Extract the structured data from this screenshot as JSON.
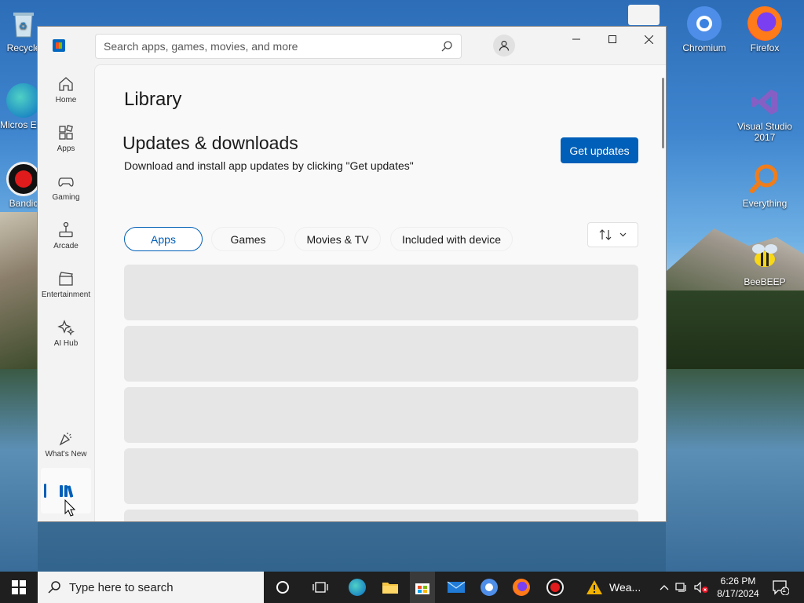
{
  "desktop": {
    "icons": [
      {
        "label": "Recycle",
        "name": "recycle-bin"
      },
      {
        "label": "Micros Edg",
        "name": "microsoft-edge"
      },
      {
        "label": "Bandic",
        "name": "bandicam"
      },
      {
        "label": "Chromium",
        "name": "chromium"
      },
      {
        "label": "Firefox",
        "name": "firefox"
      },
      {
        "label": "Visual Studio 2017",
        "name": "visual-studio"
      },
      {
        "label": "Everything",
        "name": "everything"
      },
      {
        "label": "BeeBEEP",
        "name": "beebeep"
      }
    ]
  },
  "window": {
    "search_placeholder": "Search apps, games, movies, and more"
  },
  "sidebar": {
    "items": [
      {
        "label": "Home"
      },
      {
        "label": "Apps"
      },
      {
        "label": "Gaming"
      },
      {
        "label": "Arcade"
      },
      {
        "label": "Entertainment"
      },
      {
        "label": "AI Hub"
      },
      {
        "label": "What's New"
      }
    ]
  },
  "content": {
    "page_title": "Library",
    "section_title": "Updates & downloads",
    "section_desc": "Download and install app updates by clicking \"Get updates\"",
    "get_updates_label": "Get updates",
    "filters": [
      {
        "label": "Apps",
        "active": true
      },
      {
        "label": "Games",
        "active": false
      },
      {
        "label": "Movies & TV",
        "active": false
      },
      {
        "label": "Included with device",
        "active": false
      }
    ]
  },
  "taskbar": {
    "search_text": "Type here to search",
    "weather_label": "Wea...",
    "time": "6:26 PM",
    "date": "8/17/2024",
    "notification_count": "1"
  },
  "colors": {
    "accent": "#005fb8",
    "placeholder": "#e6e6e6"
  }
}
